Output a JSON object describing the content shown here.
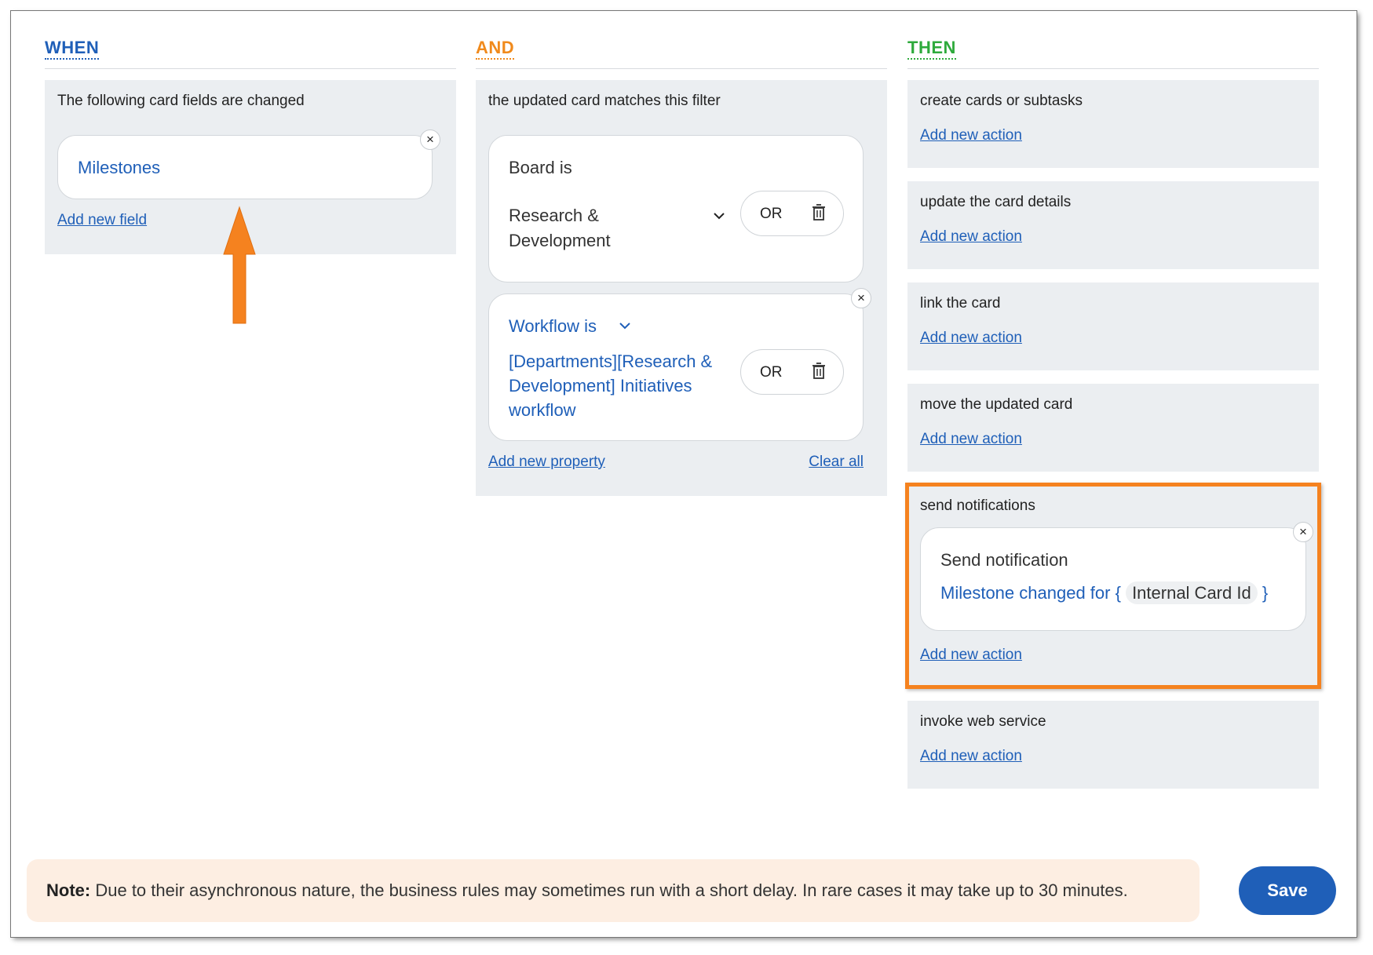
{
  "when": {
    "header": "WHEN",
    "panel_title": "The following card fields are changed",
    "field_value": "Milestones",
    "add_link": "Add new field",
    "close": "×"
  },
  "and": {
    "header": "AND",
    "panel_title": "the updated card matches this filter",
    "filters": [
      {
        "label": "Board is",
        "value": "Research & Development",
        "or": "OR"
      },
      {
        "label": "Workflow is",
        "value": "[Departments][Research & Development] Initiatives workflow",
        "or": "OR"
      }
    ],
    "add_link": "Add new property",
    "clear_link": "Clear all",
    "close": "×"
  },
  "then": {
    "header": "THEN",
    "add_link": "Add new action",
    "actions": [
      {
        "title": "create cards or subtasks"
      },
      {
        "title": "update the card details"
      },
      {
        "title": "link the card"
      },
      {
        "title": "move the updated card"
      },
      {
        "title": "send notifications"
      },
      {
        "title": "invoke web service"
      }
    ],
    "notification": {
      "title": "Send notification",
      "message_prefix": "Milestone changed for {",
      "token": "Internal Card Id",
      "message_suffix": "}",
      "close": "×"
    }
  },
  "note": {
    "label": "Note:",
    "text": "Due to their asynchronous nature, the business rules may sometimes run with a short delay. In rare cases it may take up to 30 minutes."
  },
  "save_label": "Save",
  "colors": {
    "when": "#1f5fb8",
    "and": "#f08a1c",
    "then": "#2eaa3c",
    "annotation": "#f5821f",
    "save": "#1f5fb8"
  }
}
